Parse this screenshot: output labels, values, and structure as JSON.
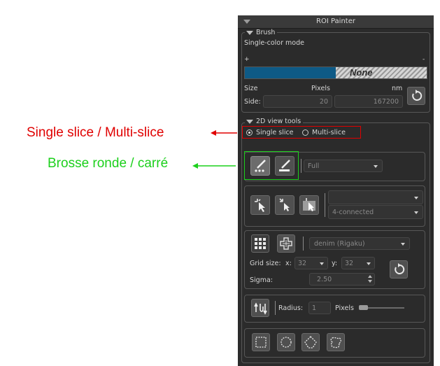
{
  "annotations": {
    "single_multi": "Single slice / Multi-slice",
    "brush_shape": "Brosse ronde / carré",
    "red_color": "#e00000",
    "green_color": "#1cd01c"
  },
  "panel": {
    "title": "ROI Painter",
    "brush": {
      "legend": "Brush",
      "mode": "Single-color mode",
      "plus": "+",
      "minus": "-",
      "color_none_label": "None",
      "size_label": "Size",
      "pixels_label": "Pixels",
      "nm_label": "nm",
      "side_label": "Side:",
      "side_pixels": "20",
      "side_nm": "167200",
      "active_color": "#0e5a86"
    },
    "view_tools": {
      "legend": "2D view tools",
      "single_slice": "Single slice",
      "multi_slice": "Multi-slice",
      "selected": "Single slice",
      "brush_mode_value": "Full",
      "connectivity_value": "4-connected",
      "filter_value": "denim (Rigaku)",
      "grid_size_label": "Grid size:",
      "x_label": "x:",
      "x_value": "32",
      "y_label": "y:",
      "y_value": "32",
      "sigma_label": "Sigma:",
      "sigma_value": "2.50",
      "radius_label": "Radius:",
      "radius_value": "1",
      "radius_unit": "Pixels"
    }
  }
}
